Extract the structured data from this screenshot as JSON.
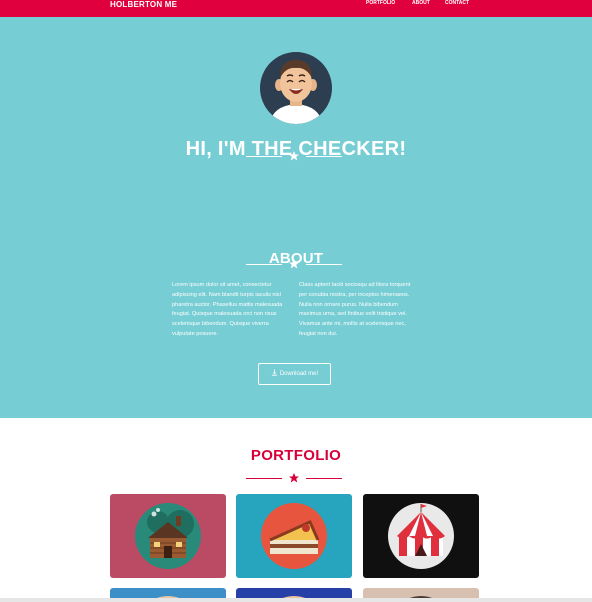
{
  "navbar": {
    "brand": "HOLBERTON ME",
    "links": [
      "PORTFOLIO",
      "ABOUT",
      "CONTACT"
    ]
  },
  "hero": {
    "title": "HI, I'M THE CHECKER!"
  },
  "about": {
    "title": "ABOUT",
    "left_text": "Lorem ipsum dolor sit amet, consectetur adipiscing elit. Nam blandit turpis iaculis nisl pharetra auctor. Phasellus mattis malesuada feugiat. Quisque malesuada orci non risus scelerisque bibendum. Quisque viverra vulputate posuere.",
    "right_text": "Class aptent taciti sociosqu ad litora torquent per conubia nostra, per inceptos himenaeos. Nulla non ornare purus. Nulla bibendum maximus urna, sed finibus velit tristique vel. Vivamus ante mi, mollis at scelerisque nec, feugiat non dui.",
    "download_label": "Download me!"
  },
  "portfolio": {
    "title": "PORTFOLIO",
    "items": [
      "cabin-illustration",
      "cake-illustration",
      "circus-tent-illustration",
      "portrait-illustration",
      "portrait-illustration",
      "portrait-illustration"
    ]
  },
  "colors": {
    "accent": "#e0003d",
    "hero_bg": "#76cdd3",
    "portfolio_title": "#d8003a"
  }
}
